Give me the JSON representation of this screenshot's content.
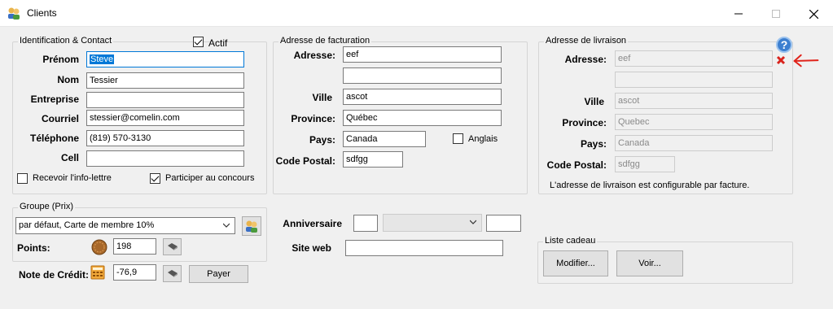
{
  "window": {
    "title": "Clients"
  },
  "ident": {
    "legend": "Identification & Contact",
    "actif_label": "Actif",
    "prenom_label": "Prénom",
    "prenom": "Steve",
    "nom_label": "Nom",
    "nom": "Tessier",
    "entreprise_label": "Entreprise",
    "entreprise": "",
    "courriel_label": "Courriel",
    "courriel": "stessier@comelin.com",
    "telephone_label": "Téléphone",
    "telephone": "(819) 570-3130",
    "cell_label": "Cell",
    "cell": "",
    "infolettre_label": "Recevoir l'info-lettre",
    "concours_label": "Participer au concours"
  },
  "facturation": {
    "legend": "Adresse de facturation",
    "adresse_label": "Adresse:",
    "adresse1": "eef",
    "adresse2": "",
    "ville_label": "Ville",
    "ville": "ascot",
    "province_label": "Province:",
    "province": "Québec",
    "pays_label": "Pays:",
    "pays": "Canada",
    "anglais_label": "Anglais",
    "code_postal_label": "Code Postal:",
    "code_postal": "sdfgg"
  },
  "livraison": {
    "legend": "Adresse de livraison",
    "adresse_label": "Adresse:",
    "adresse1": "eef",
    "adresse2": "",
    "ville_label": "Ville",
    "ville": "ascot",
    "province_label": "Province:",
    "province": "Quebec",
    "pays_label": "Pays:",
    "pays": "Canada",
    "code_postal_label": "Code Postal:",
    "code_postal": "sdfgg",
    "note": "L'adresse de livraison est configurable par facture."
  },
  "groupe": {
    "legend": "Groupe (Prix)",
    "selected": "par défaut, Carte de membre 10%",
    "points_label": "Points:",
    "points": "198"
  },
  "credit": {
    "label": "Note de Crédit:",
    "value": "-76,9",
    "payer_label": "Payer"
  },
  "anniversaire": {
    "label": "Anniversaire",
    "day": "",
    "month": "",
    "year": ""
  },
  "siteweb": {
    "label": "Site web",
    "value": ""
  },
  "liste_cadeau": {
    "legend": "Liste cadeau",
    "modifier_label": "Modifier...",
    "voir_label": "Voir..."
  },
  "help": {
    "symbol": "?"
  },
  "colors": {
    "accent": "#0078d7",
    "close_red": "#d9231c",
    "help_blue": "#3d7fd0"
  }
}
